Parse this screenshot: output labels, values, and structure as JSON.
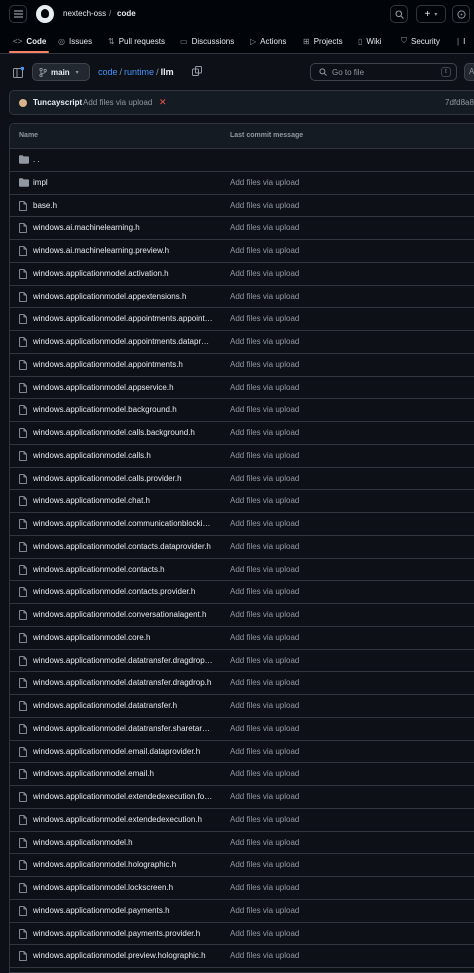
{
  "header": {
    "owner": "nextech-oss",
    "separator": "/",
    "repo": "code",
    "icons": [
      "menu-icon",
      "github-logo-icon",
      "search-icon",
      "plus-icon",
      "chevron-down-icon",
      "issues-icon"
    ]
  },
  "tabs": [
    {
      "label": "Code",
      "icon": "code-icon",
      "active": true
    },
    {
      "label": "Issues",
      "icon": "issues-icon"
    },
    {
      "label": "Pull requests",
      "icon": "pull-request-icon"
    },
    {
      "label": "Discussions",
      "icon": "discussions-icon"
    },
    {
      "label": "Actions",
      "icon": "play-icon"
    },
    {
      "label": "Projects",
      "icon": "table-icon"
    },
    {
      "label": "Wiki",
      "icon": "book-icon"
    },
    {
      "label": "Security",
      "icon": "shield-icon"
    },
    {
      "label": "I",
      "icon": "graph-icon"
    }
  ],
  "toolbar": {
    "branch": "main",
    "path": [
      "code",
      "runtime",
      "llm"
    ],
    "path_sep": "/",
    "goto_placeholder": "Go to file",
    "goto_shortcut": "t",
    "add_label": "A"
  },
  "commit": {
    "author": "Tuncayscript",
    "message": "Add files via upload",
    "status": "✕",
    "sha": "7dfd8a8"
  },
  "table": {
    "col_name": "Name",
    "col_commit": "Last commit message",
    "parent": ". .",
    "rows": [
      {
        "name": "impl",
        "type": "folder",
        "message": "Add files via upload"
      },
      {
        "name": "base.h",
        "type": "file",
        "message": "Add files via upload"
      },
      {
        "name": "windows.ai.machinelearning.h",
        "type": "file",
        "message": "Add files via upload"
      },
      {
        "name": "windows.ai.machinelearning.preview.h",
        "type": "file",
        "message": "Add files via upload"
      },
      {
        "name": "windows.applicationmodel.activation.h",
        "type": "file",
        "message": "Add files via upload"
      },
      {
        "name": "windows.applicationmodel.appextensions.h",
        "type": "file",
        "message": "Add files via upload"
      },
      {
        "name": "windows.applicationmodel.appointments.appoint…",
        "type": "file",
        "message": "Add files via upload"
      },
      {
        "name": "windows.applicationmodel.appointments.datapro…",
        "type": "file",
        "message": "Add files via upload"
      },
      {
        "name": "windows.applicationmodel.appointments.h",
        "type": "file",
        "message": "Add files via upload"
      },
      {
        "name": "windows.applicationmodel.appservice.h",
        "type": "file",
        "message": "Add files via upload"
      },
      {
        "name": "windows.applicationmodel.background.h",
        "type": "file",
        "message": "Add files via upload"
      },
      {
        "name": "windows.applicationmodel.calls.background.h",
        "type": "file",
        "message": "Add files via upload"
      },
      {
        "name": "windows.applicationmodel.calls.h",
        "type": "file",
        "message": "Add files via upload"
      },
      {
        "name": "windows.applicationmodel.calls.provider.h",
        "type": "file",
        "message": "Add files via upload"
      },
      {
        "name": "windows.applicationmodel.chat.h",
        "type": "file",
        "message": "Add files via upload"
      },
      {
        "name": "windows.applicationmodel.communicationblocki…",
        "type": "file",
        "message": "Add files via upload"
      },
      {
        "name": "windows.applicationmodel.contacts.dataprovider.h",
        "type": "file",
        "message": "Add files via upload"
      },
      {
        "name": "windows.applicationmodel.contacts.h",
        "type": "file",
        "message": "Add files via upload"
      },
      {
        "name": "windows.applicationmodel.contacts.provider.h",
        "type": "file",
        "message": "Add files via upload"
      },
      {
        "name": "windows.applicationmodel.conversationalagent.h",
        "type": "file",
        "message": "Add files via upload"
      },
      {
        "name": "windows.applicationmodel.core.h",
        "type": "file",
        "message": "Add files via upload"
      },
      {
        "name": "windows.applicationmodel.datatransfer.dragdrop.…",
        "type": "file",
        "message": "Add files via upload"
      },
      {
        "name": "windows.applicationmodel.datatransfer.dragdrop.h",
        "type": "file",
        "message": "Add files via upload"
      },
      {
        "name": "windows.applicationmodel.datatransfer.h",
        "type": "file",
        "message": "Add files via upload"
      },
      {
        "name": "windows.applicationmodel.datatransfer.sharetarg…",
        "type": "file",
        "message": "Add files via upload"
      },
      {
        "name": "windows.applicationmodel.email.dataprovider.h",
        "type": "file",
        "message": "Add files via upload"
      },
      {
        "name": "windows.applicationmodel.email.h",
        "type": "file",
        "message": "Add files via upload"
      },
      {
        "name": "windows.applicationmodel.extendedexecution.for…",
        "type": "file",
        "message": "Add files via upload"
      },
      {
        "name": "windows.applicationmodel.extendedexecution.h",
        "type": "file",
        "message": "Add files via upload"
      },
      {
        "name": "windows.applicationmodel.h",
        "type": "file",
        "message": "Add files via upload"
      },
      {
        "name": "windows.applicationmodel.holographic.h",
        "type": "file",
        "message": "Add files via upload"
      },
      {
        "name": "windows.applicationmodel.lockscreen.h",
        "type": "file",
        "message": "Add files via upload"
      },
      {
        "name": "windows.applicationmodel.payments.h",
        "type": "file",
        "message": "Add files via upload"
      },
      {
        "name": "windows.applicationmodel.payments.provider.h",
        "type": "file",
        "message": "Add files via upload"
      },
      {
        "name": "windows.applicationmodel.preview.holographic.h",
        "type": "file",
        "message": "Add files via upload"
      }
    ]
  },
  "colors": {
    "bg": "#0d1117",
    "link": "#4493f8",
    "muted": "#9198a1",
    "border": "#30363d",
    "active_tab": "#f78166",
    "error": "#f85149"
  }
}
